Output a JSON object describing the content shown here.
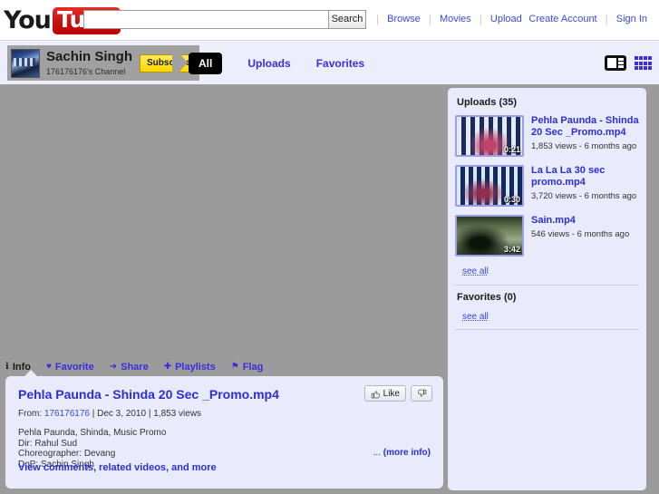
{
  "masthead": {
    "logo_you": "You",
    "logo_tube": "Tube",
    "search": {
      "value": "",
      "placeholder": ""
    },
    "search_button": "Search",
    "nav": [
      {
        "label": "Browse"
      },
      {
        "label": "Movies"
      },
      {
        "label": "Upload"
      }
    ],
    "account": [
      {
        "label": "Create Account"
      },
      {
        "label": "Sign In"
      }
    ]
  },
  "channel": {
    "name": "Sachin Singh",
    "subtitle": "176176176's Channel",
    "subscribe_label": "Subscribe",
    "nav": [
      {
        "label": "All",
        "active": true
      },
      {
        "label": "Uploads",
        "active": false
      },
      {
        "label": "Favorites",
        "active": false
      }
    ],
    "view_modes": [
      {
        "icon": "player-view-icon"
      },
      {
        "icon": "grid-view-icon"
      }
    ]
  },
  "video_tabs": [
    {
      "label": "Info",
      "glyph": "ℹ",
      "active": true
    },
    {
      "label": "Favorite",
      "glyph": "♥",
      "active": false
    },
    {
      "label": "Share",
      "glyph": "➜",
      "active": false
    },
    {
      "label": "Playlists",
      "glyph": "✚",
      "active": false
    },
    {
      "label": "Flag",
      "glyph": "⚑",
      "active": false
    }
  ],
  "info": {
    "title": "Pehla Paunda - Shinda 20 Sec _Promo.mp4",
    "from_label": "From:",
    "uploader": "176176176",
    "sep1": "|",
    "date": "Dec 3, 2010",
    "sep2": "|",
    "views": "1,853 views",
    "description_lines": [
      "Pehla Paunda, Shinda, Music Promo",
      "Dir: Rahul Sud",
      "Choreographer: Devang",
      "DoP: Sachin Singh"
    ],
    "more_info_ellipsis": "...",
    "more_info_label": "(more info)",
    "view_comments_label": "View comments, related videos, and more",
    "like_label": "Like",
    "like_icon": "thumbs-up-icon",
    "dislike_icon": "thumbs-down-icon"
  },
  "sidebar": {
    "uploads_heading": "Uploads (35)",
    "uploads": [
      {
        "title": "Pehla Paunda - Shinda 20 Sec _Promo.mp4",
        "meta": "1,853 views - 6 months ago",
        "duration": "0:21"
      },
      {
        "title": "La La La 30 sec promo.mp4",
        "meta": "3,720 views - 6 months ago",
        "duration": "0:30"
      },
      {
        "title": "Sain.mp4",
        "meta": "546 views - 6 months ago",
        "duration": "3:42"
      }
    ],
    "uploads_see_all": "see all",
    "favorites_heading": "Favorites (0)",
    "favorites_see_all": "see all"
  },
  "colors": {
    "accent_link": "#3a4ad8",
    "title_link": "#2c2ed6",
    "panel_bg": "#e9eafb",
    "player_bg": "#9b9b9b",
    "subscribe_yellow": "#ffd900",
    "brand_red": "#c3140e"
  }
}
